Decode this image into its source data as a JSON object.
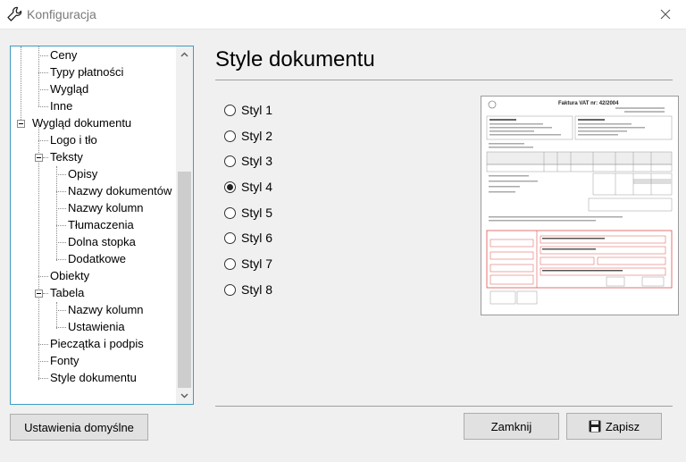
{
  "window": {
    "title": "Konfiguracja",
    "icon": "wrench-icon"
  },
  "tree": {
    "items": [
      {
        "label": "Ceny",
        "level": 2
      },
      {
        "label": "Typy płatności",
        "level": 2
      },
      {
        "label": "Wygląd",
        "level": 2
      },
      {
        "label": "Inne",
        "level": 2
      },
      {
        "label": "Wygląd dokumentu",
        "level": 1,
        "expanded": true
      },
      {
        "label": "Logo i tło",
        "level": 2
      },
      {
        "label": "Teksty",
        "level": 2,
        "expanded": true
      },
      {
        "label": "Opisy",
        "level": 3
      },
      {
        "label": "Nazwy dokumentów",
        "level": 3
      },
      {
        "label": "Nazwy kolumn",
        "level": 3
      },
      {
        "label": "Tłumaczenia",
        "level": 3
      },
      {
        "label": "Dolna stopka",
        "level": 3
      },
      {
        "label": "Dodatkowe",
        "level": 3
      },
      {
        "label": "Obiekty",
        "level": 2
      },
      {
        "label": "Tabela",
        "level": 2,
        "expanded": true
      },
      {
        "label": "Nazwy kolumn",
        "level": 3
      },
      {
        "label": "Ustawienia",
        "level": 3
      },
      {
        "label": "Pieczątka i podpis",
        "level": 2
      },
      {
        "label": "Fonty",
        "level": 2
      },
      {
        "label": "Style dokumentu",
        "level": 2
      }
    ]
  },
  "main": {
    "heading": "Style dokumentu",
    "styles": [
      {
        "label": "Styl 1",
        "checked": false
      },
      {
        "label": "Styl 2",
        "checked": false
      },
      {
        "label": "Styl 3",
        "checked": false
      },
      {
        "label": "Styl 4",
        "checked": true
      },
      {
        "label": "Styl 5",
        "checked": false
      },
      {
        "label": "Styl 6",
        "checked": false
      },
      {
        "label": "Styl 7",
        "checked": false
      },
      {
        "label": "Styl 8",
        "checked": false
      }
    ],
    "preview": {
      "doc_title": "Faktura VAT nr: 42/2004",
      "accent_color": "#d9534f"
    }
  },
  "buttons": {
    "defaults": "Ustawienia domyślne",
    "close": "Zamknij",
    "save": "Zapisz"
  },
  "colors": {
    "tree_border": "#3c9cc4",
    "dialog_bg": "#f0f0f0"
  }
}
